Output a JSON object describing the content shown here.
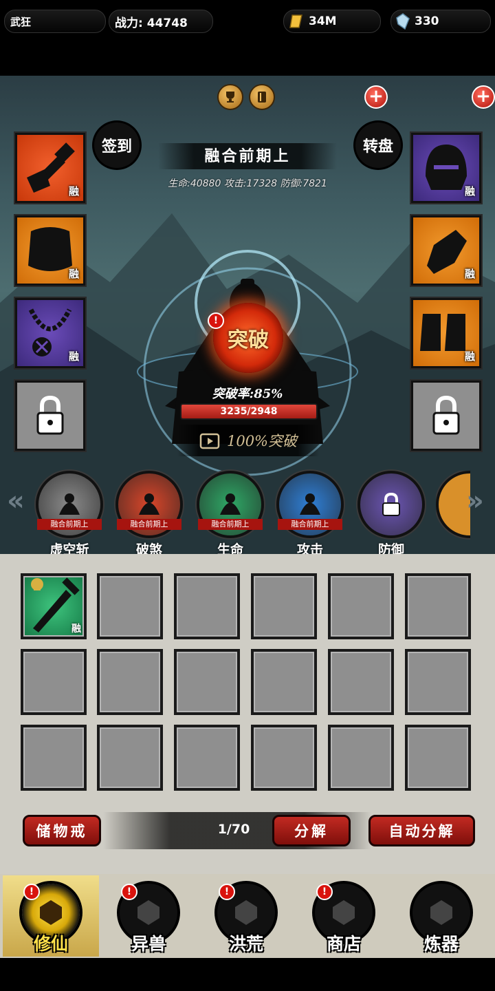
{
  "header": {
    "player_name": "武狂",
    "power_label": "战力: 44748",
    "gold": "34M",
    "crystals": "330"
  },
  "side_buttons": {
    "checkin": "签到",
    "wheel": "转盘"
  },
  "stage": {
    "title": "融合前期上",
    "stats": "生命:40880  攻击:17328  防御:7821",
    "breakthrough_label": "突破",
    "rate_text": "突破率:85%",
    "progress_text": "3235/2948",
    "progress_fraction": 1.0,
    "ad_button": "100%突破"
  },
  "equip_tag": "融",
  "skills": [
    {
      "stage": "融合前期上",
      "name": "虚空斩",
      "color": "#8a8a8a"
    },
    {
      "stage": "融合前期上",
      "name": "破煞",
      "color": "#d9462a"
    },
    {
      "stage": "融合前期上",
      "name": "生命",
      "color": "#2fa866"
    },
    {
      "stage": "融合前期上",
      "name": "攻击",
      "color": "#2f7fd6"
    },
    {
      "stage": "",
      "name": "防御",
      "color": "#6b55b3"
    }
  ],
  "inventory": {
    "count": "1/70",
    "storage_button": "储物戒",
    "decompose_button": "分解",
    "auto_decompose_button": "自动分解",
    "item_tag": "融"
  },
  "nav": [
    {
      "label": "修仙",
      "alert": true
    },
    {
      "label": "异兽",
      "alert": true
    },
    {
      "label": "洪荒",
      "alert": true
    },
    {
      "label": "商店",
      "alert": true
    },
    {
      "label": "炼器",
      "alert": false
    }
  ]
}
